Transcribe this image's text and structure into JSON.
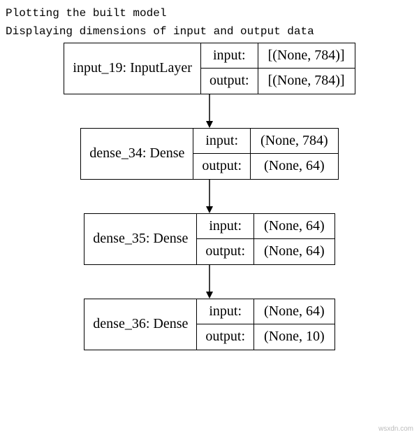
{
  "header": {
    "line1": "Plotting the built model",
    "line2": "Displaying dimensions of input and output data"
  },
  "labels": {
    "input": "input:",
    "output": "output:"
  },
  "layers": [
    {
      "name": "input_19: InputLayer",
      "input": "[(None, 784)]",
      "output": "[(None, 784)]"
    },
    {
      "name": "dense_34: Dense",
      "input": "(None, 784)",
      "output": "(None, 64)"
    },
    {
      "name": "dense_35: Dense",
      "input": "(None, 64)",
      "output": "(None, 64)"
    },
    {
      "name": "dense_36: Dense",
      "input": "(None, 64)",
      "output": "(None, 10)"
    }
  ],
  "watermark": "wsxdn.com"
}
